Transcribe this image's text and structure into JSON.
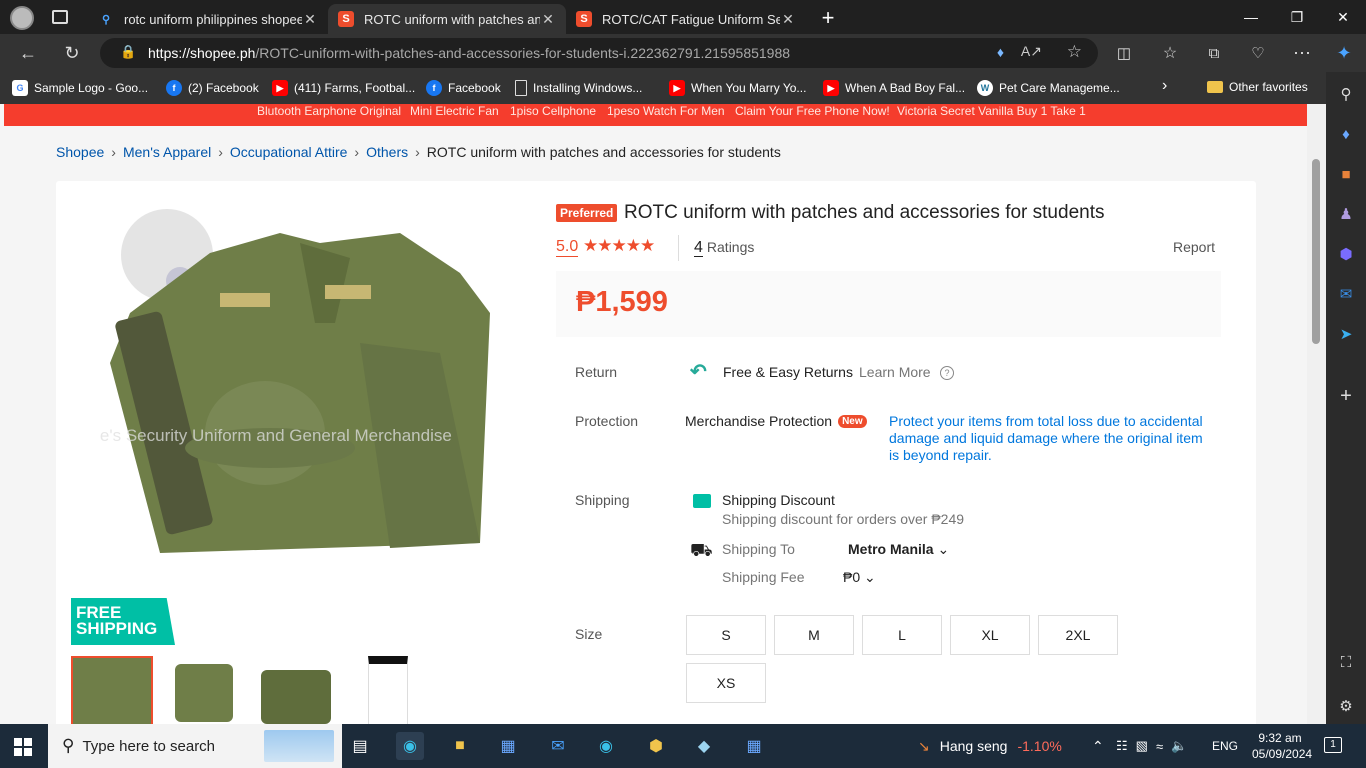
{
  "browser": {
    "tabs": [
      {
        "title": "rotc uniform philippines shopee -",
        "icon": "search-icon",
        "active": false
      },
      {
        "title": "ROTC uniform with patches and a",
        "icon": "shopee-icon",
        "active": true
      },
      {
        "title": "ROTC/CAT Fatigue Uniform Set wi",
        "icon": "shopee-icon",
        "active": false
      }
    ],
    "url_host": "https://shopee.ph",
    "url_path": "/ROTC-uniform-with-patches-and-accessories-for-students-i.222362791.21595851988",
    "bookmarks": [
      {
        "label": "Sample Logo - Goo...",
        "icon": "google-icon"
      },
      {
        "label": "(2) Facebook",
        "icon": "facebook-icon"
      },
      {
        "label": "(411) Farms, Footbal...",
        "icon": "youtube-icon"
      },
      {
        "label": "Facebook",
        "icon": "facebook-icon"
      },
      {
        "label": "Installing Windows...",
        "icon": "page-icon"
      },
      {
        "label": "When You Marry Yo...",
        "icon": "youtube-icon"
      },
      {
        "label": "When A Bad Boy Fal...",
        "icon": "youtube-icon"
      },
      {
        "label": "Pet Care Manageme...",
        "icon": "wordpress-icon"
      }
    ],
    "other_favorites": "Other favorites"
  },
  "promo_links": [
    "Blutooth Earphone Original",
    "Mini Electric Fan",
    "1piso Cellphone",
    "1peso Watch For Men",
    "Claim Your Free Phone Now!",
    "Victoria Secret Vanilla Buy 1 Take 1"
  ],
  "breadcrumb": {
    "items": [
      "Shopee",
      "Men's Apparel",
      "Occupational Attire",
      "Others"
    ],
    "current": "ROTC uniform with patches and accessories for students"
  },
  "product": {
    "badge": "Preferred",
    "title": "ROTC uniform with patches and accessories for students",
    "rating": "5.0",
    "stars": 5,
    "rating_count": "4",
    "rating_label": "Ratings",
    "report": "Report",
    "price": "₱1,599",
    "watermark": "Che's Security Uniform and General Merchandise",
    "free_shipping": [
      "FREE",
      "SHIPPING"
    ],
    "return_label": "Return",
    "return_text": "Free & Easy Returns",
    "learn_more": "Learn More",
    "protection_label": "Protection",
    "protection_text": "Merchandise Protection",
    "new_badge": "New",
    "protection_desc": "Protect your items from total loss due to accidental damage and liquid damage where the original item is beyond repair.",
    "shipping_label": "Shipping",
    "shipping_discount": "Shipping Discount",
    "shipping_discount_desc": "Shipping discount for orders over ₱249",
    "shipping_to_label": "Shipping To",
    "shipping_to": "Metro Manila",
    "shipping_fee_label": "Shipping Fee",
    "shipping_fee": "₱0",
    "size_label": "Size",
    "sizes": [
      "S",
      "M",
      "L",
      "XL",
      "2XL",
      "XS"
    ]
  },
  "taskbar": {
    "search_placeholder": "Type here to search",
    "stock_name": "Hang seng",
    "stock_change": "-1.10%",
    "language": "ENG",
    "time": "9:32 am",
    "date": "05/09/2024",
    "notifications": "1"
  }
}
